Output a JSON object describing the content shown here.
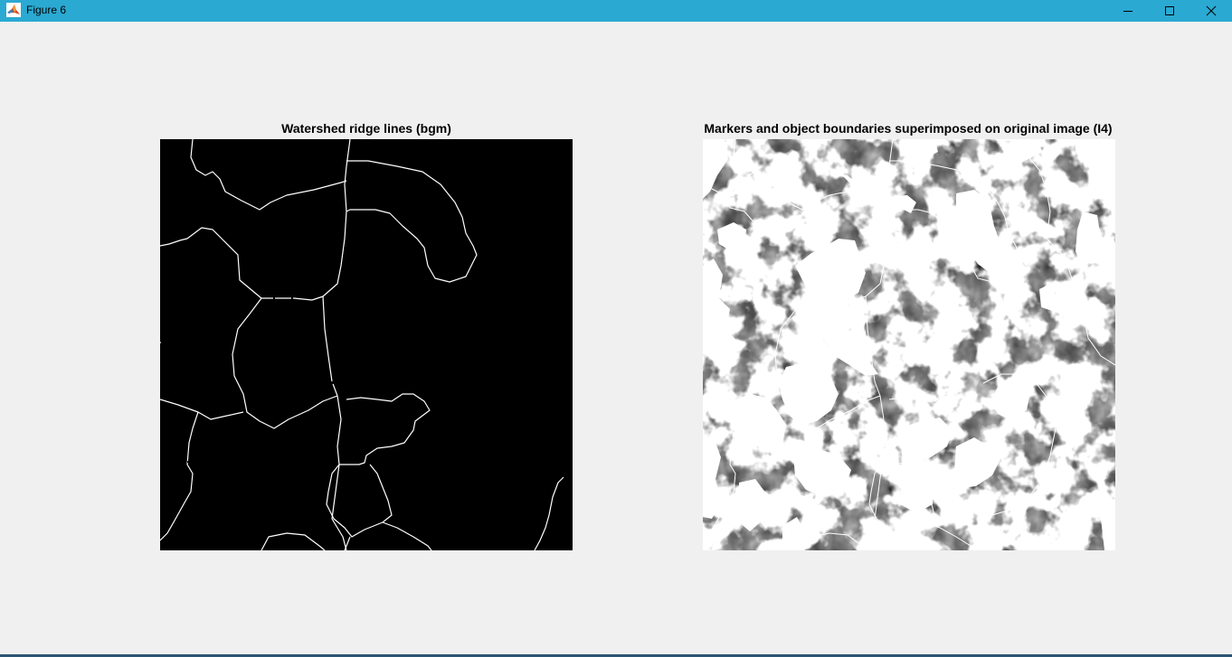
{
  "window": {
    "title": "Figure 6",
    "app_icon": "matlab-logo-icon",
    "controls": [
      "minimize-icon",
      "maximize-icon",
      "close-icon"
    ],
    "titlebar_color": "#2aa9d2"
  },
  "figure": {
    "background": "#f0f0f0",
    "axes": [
      {
        "title": "Watershed ridge lines (bgm)",
        "image": "binary ridge-line image: white thin lines on black background"
      },
      {
        "title": "Markers and object boundaries superimposed on original image (I4)",
        "image": "grayscale textured image with white markers and white boundary lines"
      }
    ]
  }
}
